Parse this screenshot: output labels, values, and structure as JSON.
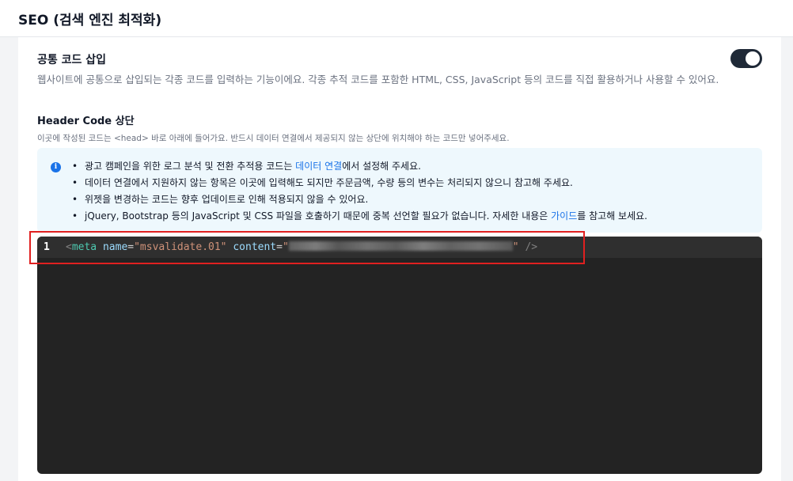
{
  "header": {
    "title": "SEO (검색 엔진 최적화)"
  },
  "section": {
    "title": "공통 코드 삽입",
    "description": "웹사이트에 공통으로 삽입되는 각종 코드를 입력하는 기능이에요. 각종 추적 코드를 포함한 HTML, CSS, JavaScript 등의 코드를 직접 활용하거나 사용할 수 있어요.",
    "toggle_on": true
  },
  "header_code": {
    "title": "Header Code 상단",
    "description": "이곳에 작성된 코드는 <head> 바로 아래에 들어가요. 반드시 데이터 연결에서 제공되지 않는 상단에 위치해야 하는 코드만 넣어주세요."
  },
  "info": {
    "icon": "info-icon",
    "item1_prefix": "광고 캠페인을 위한 로그 분석 및 전환 추적용 코드는 ",
    "item1_link": "데이터 연결",
    "item1_suffix": "에서 설정해 주세요.",
    "item2": "데이터 연결에서 지원하지 않는 항목은 이곳에 입력해도 되지만 주문금액, 수량 등의 변수는 처리되지 않으니 참고해 주세요.",
    "item3": "위젯을 변경하는 코드는 향후 업데이트로 인해 적용되지 않을 수 있어요.",
    "item4_prefix": "jQuery, Bootstrap 등의 JavaScript 및 CSS 파일을 호출하기 때문에 중복 선언할 필요가 없습니다. 자세한 내용은 ",
    "item4_link": "가이드",
    "item4_suffix": "를 참고해 보세요.",
    "link_color": "#1a73e8"
  },
  "editor": {
    "line_number": "1",
    "tok_open": "<",
    "tok_tag": "meta",
    "tok_attr1": "name",
    "tok_eq": "=",
    "tok_val1": "\"msvalidate.01\"",
    "tok_attr2": "content",
    "tok_quote": "\"",
    "tok_close": "/>"
  },
  "colors": {
    "highlight": "#e02020",
    "editor_bg": "#232323"
  }
}
